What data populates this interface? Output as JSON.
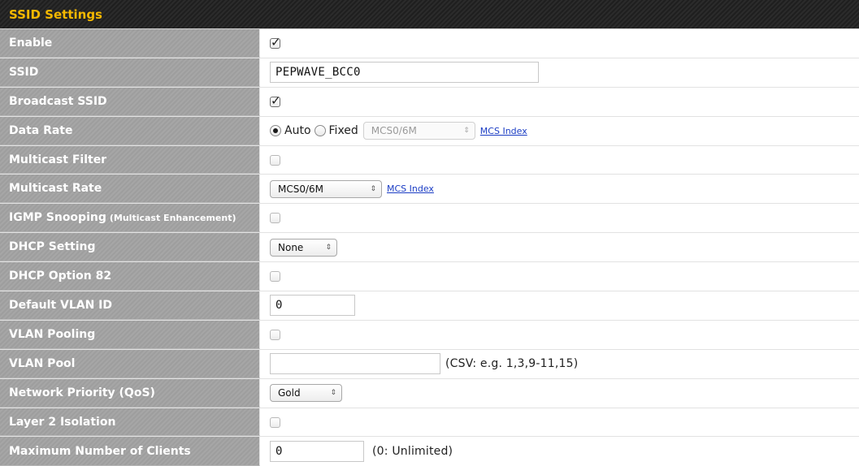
{
  "title": "SSID Settings",
  "enable": {
    "label": "Enable",
    "checked": true
  },
  "ssid": {
    "label": "SSID",
    "value": "PEPWAVE_BCC0"
  },
  "broadcast_ssid": {
    "label": "Broadcast SSID",
    "checked": true
  },
  "data_rate": {
    "label": "Data Rate",
    "auto_label": "Auto",
    "fixed_label": "Fixed",
    "selected": "Auto",
    "rate_select": "MCS0/6M",
    "link": "MCS Index"
  },
  "multicast_filter": {
    "label": "Multicast Filter",
    "checked": false
  },
  "multicast_rate": {
    "label": "Multicast Rate",
    "value": "MCS0/6M",
    "link": "MCS Index"
  },
  "igmp_snooping": {
    "label": "IGMP Snooping",
    "sublabel": "(Multicast Enhancement)",
    "checked": false
  },
  "dhcp_setting": {
    "label": "DHCP Setting",
    "value": "None"
  },
  "dhcp_option_82": {
    "label": "DHCP Option 82",
    "checked": false
  },
  "default_vlan_id": {
    "label": "Default VLAN ID",
    "value": "0"
  },
  "vlan_pooling": {
    "label": "VLAN Pooling",
    "checked": false
  },
  "vlan_pool": {
    "label": "VLAN Pool",
    "value": "",
    "hint": "(CSV: e.g. 1,3,9-11,15)"
  },
  "network_priority": {
    "label": "Network Priority (QoS)",
    "value": "Gold"
  },
  "layer2_isolation": {
    "label": "Layer 2 Isolation",
    "checked": false
  },
  "max_clients": {
    "label": "Maximum Number of Clients",
    "value": "0",
    "hint": "(0: Unlimited)"
  }
}
